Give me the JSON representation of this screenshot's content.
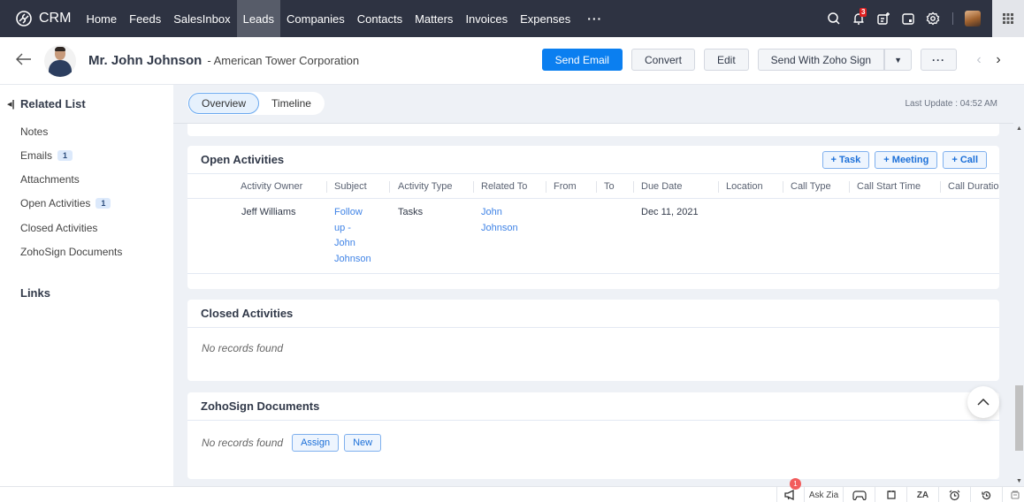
{
  "app": {
    "name": "CRM"
  },
  "topnav": {
    "items": [
      "Home",
      "Feeds",
      "SalesInbox",
      "Leads",
      "Companies",
      "Contacts",
      "Matters",
      "Invoices",
      "Expenses"
    ],
    "active": "Leads",
    "more": "···",
    "notification_count": "3",
    "icons": [
      "search-icon",
      "bell-icon",
      "new-item-icon",
      "calendar-icon",
      "gear-icon",
      "user-avatar",
      "apps-grid-icon"
    ]
  },
  "record": {
    "name": "Mr. John Johnson",
    "company": "- American Tower Corporation",
    "actions": {
      "send_email": "Send Email",
      "convert": "Convert",
      "edit": "Edit",
      "send_zoho_sign": "Send With Zoho Sign",
      "more": "···"
    }
  },
  "sidebar": {
    "title": "Related List",
    "items": [
      {
        "label": "Notes",
        "count": null
      },
      {
        "label": "Emails",
        "count": "1"
      },
      {
        "label": "Attachments",
        "count": null
      },
      {
        "label": "Open Activities",
        "count": "1"
      },
      {
        "label": "Closed Activities",
        "count": null
      },
      {
        "label": "ZohoSign Documents",
        "count": null
      }
    ],
    "links_title": "Links"
  },
  "main": {
    "tabs": [
      "Overview",
      "Timeline"
    ],
    "active_tab": "Overview",
    "last_update": "Last Update : 04:52 AM"
  },
  "open_activities": {
    "title": "Open Activities",
    "buttons": [
      "+ Task",
      "+ Meeting",
      "+ Call"
    ],
    "columns": [
      "Activity Owner",
      "Subject",
      "Activity Type",
      "Related To",
      "From",
      "To",
      "Due Date",
      "Location",
      "Call Type",
      "Call Start Time",
      "Call Duratio"
    ],
    "rows": [
      {
        "owner": "Jeff Williams",
        "subject_lines": [
          "Follow",
          "up -",
          "John",
          "Johnson"
        ],
        "type": "Tasks",
        "related_lines": [
          "John",
          "Johnson"
        ],
        "from": "",
        "to": "",
        "due": "Dec 11, 2021",
        "location": "",
        "call_type": "",
        "call_start": "",
        "call_duration": ""
      }
    ]
  },
  "closed_activities": {
    "title": "Closed Activities",
    "empty": "No records found"
  },
  "zohosign": {
    "title": "ZohoSign Documents",
    "empty": "No records found",
    "buttons": [
      "Assign",
      "New"
    ]
  },
  "bottom_bar": {
    "announcement_badge": "1",
    "ask_zia": "Ask Zia"
  }
}
